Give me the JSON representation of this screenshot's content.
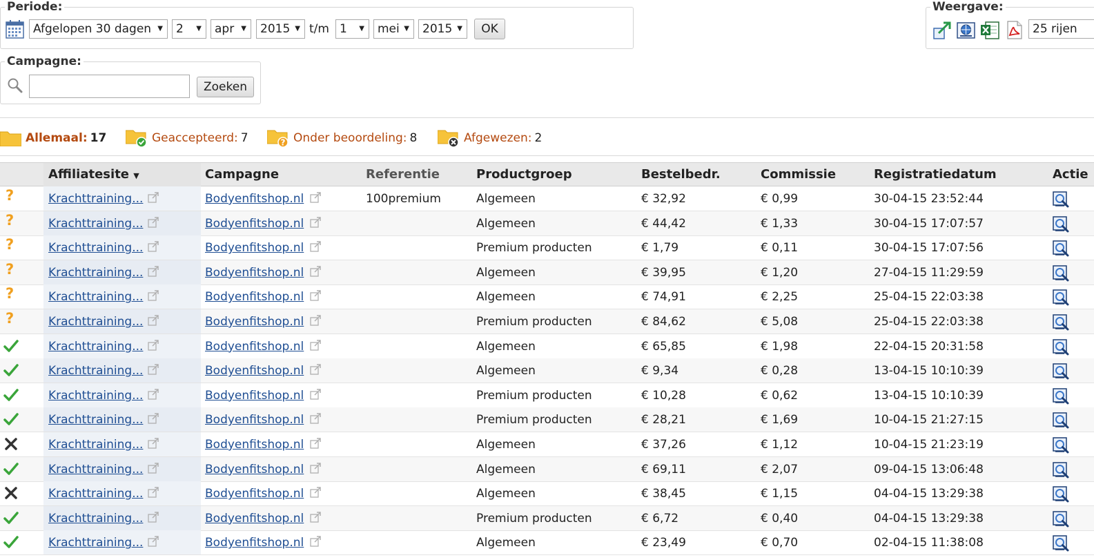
{
  "periode": {
    "legend": "Periode:",
    "preset": "Afgelopen 30 dagen",
    "from_day": "2",
    "from_month": "apr",
    "from_year": "2015",
    "tm_label": "t/m",
    "to_day": "1",
    "to_month": "mei",
    "to_year": "2015",
    "ok_label": "OK",
    "icon": "calendar-icon"
  },
  "campagne": {
    "legend": "Campagne:",
    "search_value": "",
    "search_button": "Zoeken",
    "icon": "magnifier-icon"
  },
  "weergave": {
    "legend": "Weergave:",
    "icons": [
      "export-icon",
      "web-icon",
      "excel-icon",
      "pdf-icon"
    ],
    "rows_select": "25 rijen"
  },
  "filters": [
    {
      "label": "Allemaal:",
      "count": "17",
      "icon": "folder-icon"
    },
    {
      "label": "Geaccepteerd:",
      "count": "7",
      "icon": "folder-check-icon"
    },
    {
      "label": "Onder beoordeling:",
      "count": "8",
      "icon": "folder-question-icon"
    },
    {
      "label": "Afgewezen:",
      "count": "2",
      "icon": "folder-rejected-icon"
    }
  ],
  "table": {
    "headers": {
      "affiliatesite": "Affiliatesite",
      "campagne": "Campagne",
      "referentie": "Referentie",
      "productgroep": "Productgroep",
      "bestelbedrag": "Bestelbedr.",
      "commissie": "Commissie",
      "registratiedatum": "Registratiedatum",
      "actie": "Actie"
    },
    "rows": [
      {
        "status": "?",
        "affiliate": "Krachttraining...",
        "campagne": "Bodyenfitshop.nl",
        "referentie": "100premium",
        "productgroep": "Algemeen",
        "bestelbedrag": "€ 32,92",
        "commissie": "€ 0,99",
        "datum": "30-04-15 23:52:44"
      },
      {
        "status": "?",
        "affiliate": "Krachttraining...",
        "campagne": "Bodyenfitshop.nl",
        "referentie": "",
        "productgroep": "Algemeen",
        "bestelbedrag": "€ 44,42",
        "commissie": "€ 1,33",
        "datum": "30-04-15 17:07:57"
      },
      {
        "status": "?",
        "affiliate": "Krachttraining...",
        "campagne": "Bodyenfitshop.nl",
        "referentie": "",
        "productgroep": "Premium producten",
        "bestelbedrag": "€ 1,79",
        "commissie": "€ 0,11",
        "datum": "30-04-15 17:07:56"
      },
      {
        "status": "?",
        "affiliate": "Krachttraining...",
        "campagne": "Bodyenfitshop.nl",
        "referentie": "",
        "productgroep": "Algemeen",
        "bestelbedrag": "€ 39,95",
        "commissie": "€ 1,20",
        "datum": "27-04-15 11:29:59"
      },
      {
        "status": "?",
        "affiliate": "Krachttraining...",
        "campagne": "Bodyenfitshop.nl",
        "referentie": "",
        "productgroep": "Algemeen",
        "bestelbedrag": "€ 74,91",
        "commissie": "€ 2,25",
        "datum": "25-04-15 22:03:38"
      },
      {
        "status": "?",
        "affiliate": "Krachttraining...",
        "campagne": "Bodyenfitshop.nl",
        "referentie": "",
        "productgroep": "Premium producten",
        "bestelbedrag": "€ 84,62",
        "commissie": "€ 5,08",
        "datum": "25-04-15 22:03:38"
      },
      {
        "status": "ok",
        "affiliate": "Krachttraining...",
        "campagne": "Bodyenfitshop.nl",
        "referentie": "",
        "productgroep": "Algemeen",
        "bestelbedrag": "€ 65,85",
        "commissie": "€ 1,98",
        "datum": "22-04-15 20:31:58"
      },
      {
        "status": "ok",
        "affiliate": "Krachttraining...",
        "campagne": "Bodyenfitshop.nl",
        "referentie": "",
        "productgroep": "Algemeen",
        "bestelbedrag": "€ 9,34",
        "commissie": "€ 0,28",
        "datum": "13-04-15 10:10:39"
      },
      {
        "status": "ok",
        "affiliate": "Krachttraining...",
        "campagne": "Bodyenfitshop.nl",
        "referentie": "",
        "productgroep": "Premium producten",
        "bestelbedrag": "€ 10,28",
        "commissie": "€ 0,62",
        "datum": "13-04-15 10:10:39"
      },
      {
        "status": "ok",
        "affiliate": "Krachttraining...",
        "campagne": "Bodyenfitshop.nl",
        "referentie": "",
        "productgroep": "Premium producten",
        "bestelbedrag": "€ 28,21",
        "commissie": "€ 1,69",
        "datum": "10-04-15 21:27:15"
      },
      {
        "status": "x",
        "affiliate": "Krachttraining...",
        "campagne": "Bodyenfitshop.nl",
        "referentie": "",
        "productgroep": "Algemeen",
        "bestelbedrag": "€ 37,26",
        "commissie": "€ 1,12",
        "datum": "10-04-15 21:23:19"
      },
      {
        "status": "ok",
        "affiliate": "Krachttraining...",
        "campagne": "Bodyenfitshop.nl",
        "referentie": "",
        "productgroep": "Algemeen",
        "bestelbedrag": "€ 69,11",
        "commissie": "€ 2,07",
        "datum": "09-04-15 13:06:48"
      },
      {
        "status": "x",
        "affiliate": "Krachttraining...",
        "campagne": "Bodyenfitshop.nl",
        "referentie": "",
        "productgroep": "Algemeen",
        "bestelbedrag": "€ 38,45",
        "commissie": "€ 1,15",
        "datum": "04-04-15 13:29:38"
      },
      {
        "status": "ok",
        "affiliate": "Krachttraining...",
        "campagne": "Bodyenfitshop.nl",
        "referentie": "",
        "productgroep": "Premium producten",
        "bestelbedrag": "€ 6,72",
        "commissie": "€ 0,40",
        "datum": "04-04-15 13:29:38"
      },
      {
        "status": "ok",
        "affiliate": "Krachttraining...",
        "campagne": "Bodyenfitshop.nl",
        "referentie": "",
        "productgroep": "Algemeen",
        "bestelbedrag": "€ 23,49",
        "commissie": "€ 0,70",
        "datum": "02-04-15 11:38:08"
      }
    ]
  },
  "colors": {
    "link": "#1f4e93",
    "filter_label": "#b44a10",
    "status_pending": "#f0a020",
    "status_accepted": "#3aa53a",
    "status_rejected": "#333333"
  }
}
